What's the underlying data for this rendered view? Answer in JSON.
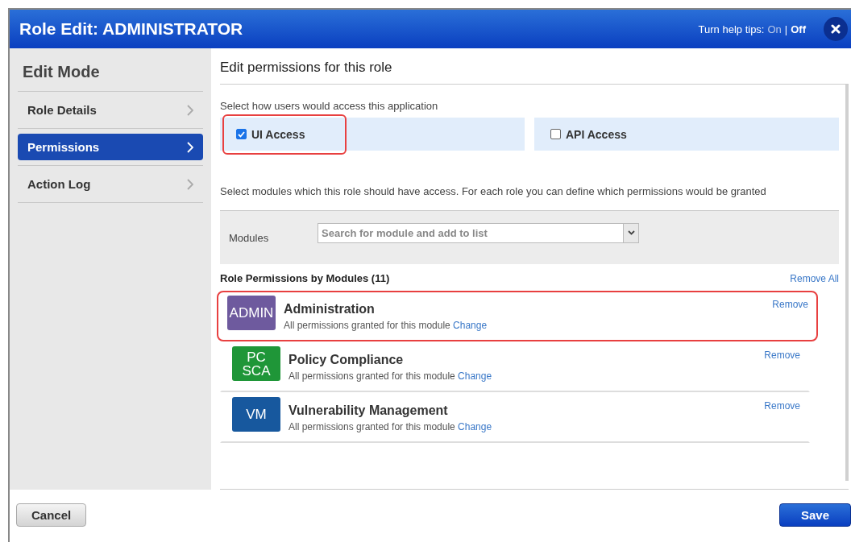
{
  "window": {
    "title": "Role Edit: ADMINISTRATOR"
  },
  "help_tips": {
    "label": "Turn help tips:",
    "options": [
      {
        "label": "On",
        "selected": false
      },
      {
        "label": "Off",
        "selected": true
      }
    ],
    "separator": "|"
  },
  "sidebar": {
    "title": "Edit Mode",
    "items": [
      {
        "label": "Role Details",
        "selected": false
      },
      {
        "label": "Permissions",
        "selected": true
      },
      {
        "label": "Action Log",
        "selected": false
      }
    ]
  },
  "content": {
    "title": "Edit permissions for this role",
    "access_prompt": "Select how users would access this application",
    "access_options": [
      {
        "label": "UI Access",
        "checked": true,
        "highlighted": true
      },
      {
        "label": "API Access",
        "checked": false,
        "highlighted": false
      }
    ],
    "modules_prompt": "Select modules which this role should have access. For each role you can define which permissions would be granted",
    "modules_field": {
      "label": "Modules",
      "placeholder": "Search for module and add to list"
    },
    "list_title": "Role Permissions by Modules (11)",
    "remove_all": "Remove All",
    "modules": [
      {
        "badge": "ADMIN",
        "color": "#6e5a9e",
        "name": "Administration",
        "note": "All permissions granted for this module",
        "link": "Change",
        "remove": "Remove",
        "highlighted": true
      },
      {
        "badge": "PC SCA",
        "color": "#1f9638",
        "name": "Policy Compliance",
        "note": "All permissions granted for this module",
        "link": "Change",
        "remove": "Remove",
        "highlighted": false
      },
      {
        "badge": "VM",
        "color": "#17589e",
        "name": "Vulnerability Management",
        "note": "All permissions granted for this module",
        "link": "Change",
        "remove": "Remove",
        "highlighted": false
      }
    ]
  },
  "buttons": {
    "cancel": "Cancel",
    "save": "Save"
  }
}
